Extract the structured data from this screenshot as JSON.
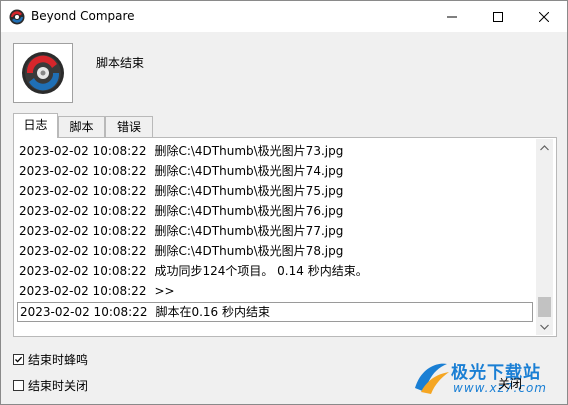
{
  "window": {
    "title": "Beyond Compare"
  },
  "header": {
    "heading": "脚本结束"
  },
  "tabs": [
    {
      "label": "日志"
    },
    {
      "label": "脚本"
    },
    {
      "label": "错误"
    }
  ],
  "log": {
    "rows": [
      {
        "time": "2023-02-02 10:08:22",
        "message": "删除C:\\4DThumb\\极光图片73.jpg"
      },
      {
        "time": "2023-02-02 10:08:22",
        "message": "删除C:\\4DThumb\\极光图片74.jpg"
      },
      {
        "time": "2023-02-02 10:08:22",
        "message": "删除C:\\4DThumb\\极光图片75.jpg"
      },
      {
        "time": "2023-02-02 10:08:22",
        "message": "删除C:\\4DThumb\\极光图片76.jpg"
      },
      {
        "time": "2023-02-02 10:08:22",
        "message": "删除C:\\4DThumb\\极光图片77.jpg"
      },
      {
        "time": "2023-02-02 10:08:22",
        "message": "删除C:\\4DThumb\\极光图片78.jpg"
      },
      {
        "time": "2023-02-02 10:08:22",
        "message": "成功同步124个项目。  0.14 秒内结束。"
      },
      {
        "time": "2023-02-02 10:08:22",
        "message": ">>"
      },
      {
        "time": "2023-02-02 10:08:22",
        "message": "脚本在0.16 秒内结束"
      }
    ]
  },
  "options": {
    "beep_label": "结束时蜂鸣",
    "beep_checked": true,
    "close_label": "结束时关闭",
    "close_checked": false
  },
  "buttons": {
    "close_label": "关闭"
  },
  "watermark": {
    "text": "极光下载站",
    "url": "www.xz7.com"
  },
  "colors": {
    "accent": "#1a7fd4",
    "logo_red": "#d6252b",
    "logo_blue": "#1f6fb5"
  }
}
